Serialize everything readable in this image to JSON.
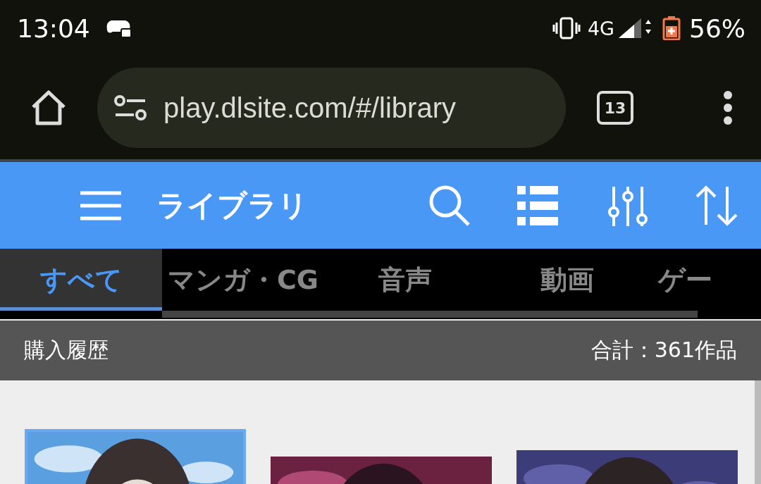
{
  "status_bar": {
    "time": "13:04",
    "network": "4G",
    "battery": "56%"
  },
  "browser": {
    "url": "play.dlsite.com/#/library",
    "tab_count": "13"
  },
  "app_bar": {
    "title": "ライブラリ"
  },
  "tabs": [
    {
      "label": "すべて",
      "selected": true
    },
    {
      "label": "マンガ・CG",
      "selected": false
    },
    {
      "label": "音声",
      "selected": false
    },
    {
      "label": "動画",
      "selected": false
    },
    {
      "label": "ゲー",
      "selected": false
    }
  ],
  "section": {
    "title": "購入履歴",
    "total": "合計：361作品"
  },
  "works": [
    {
      "kind": "picture",
      "selected": true
    },
    {
      "kind": "picture",
      "selected": false
    },
    {
      "kind": "picture",
      "selected": false
    }
  ]
}
